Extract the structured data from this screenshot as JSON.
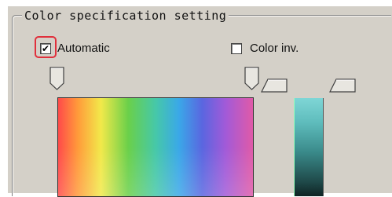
{
  "group": {
    "title": "Color specification setting"
  },
  "automatic": {
    "label": "Automatic",
    "checked": true,
    "check_glyph": "✔"
  },
  "color_inv": {
    "label": "Color inv.",
    "checked": false
  },
  "colors": {
    "panel_bg": "#d4d0c8",
    "highlight": "#e0303c"
  },
  "icons": [
    "hue-left-slider-icon",
    "hue-right-slider-icon",
    "range-low-slider-icon",
    "range-high-slider-icon"
  ]
}
